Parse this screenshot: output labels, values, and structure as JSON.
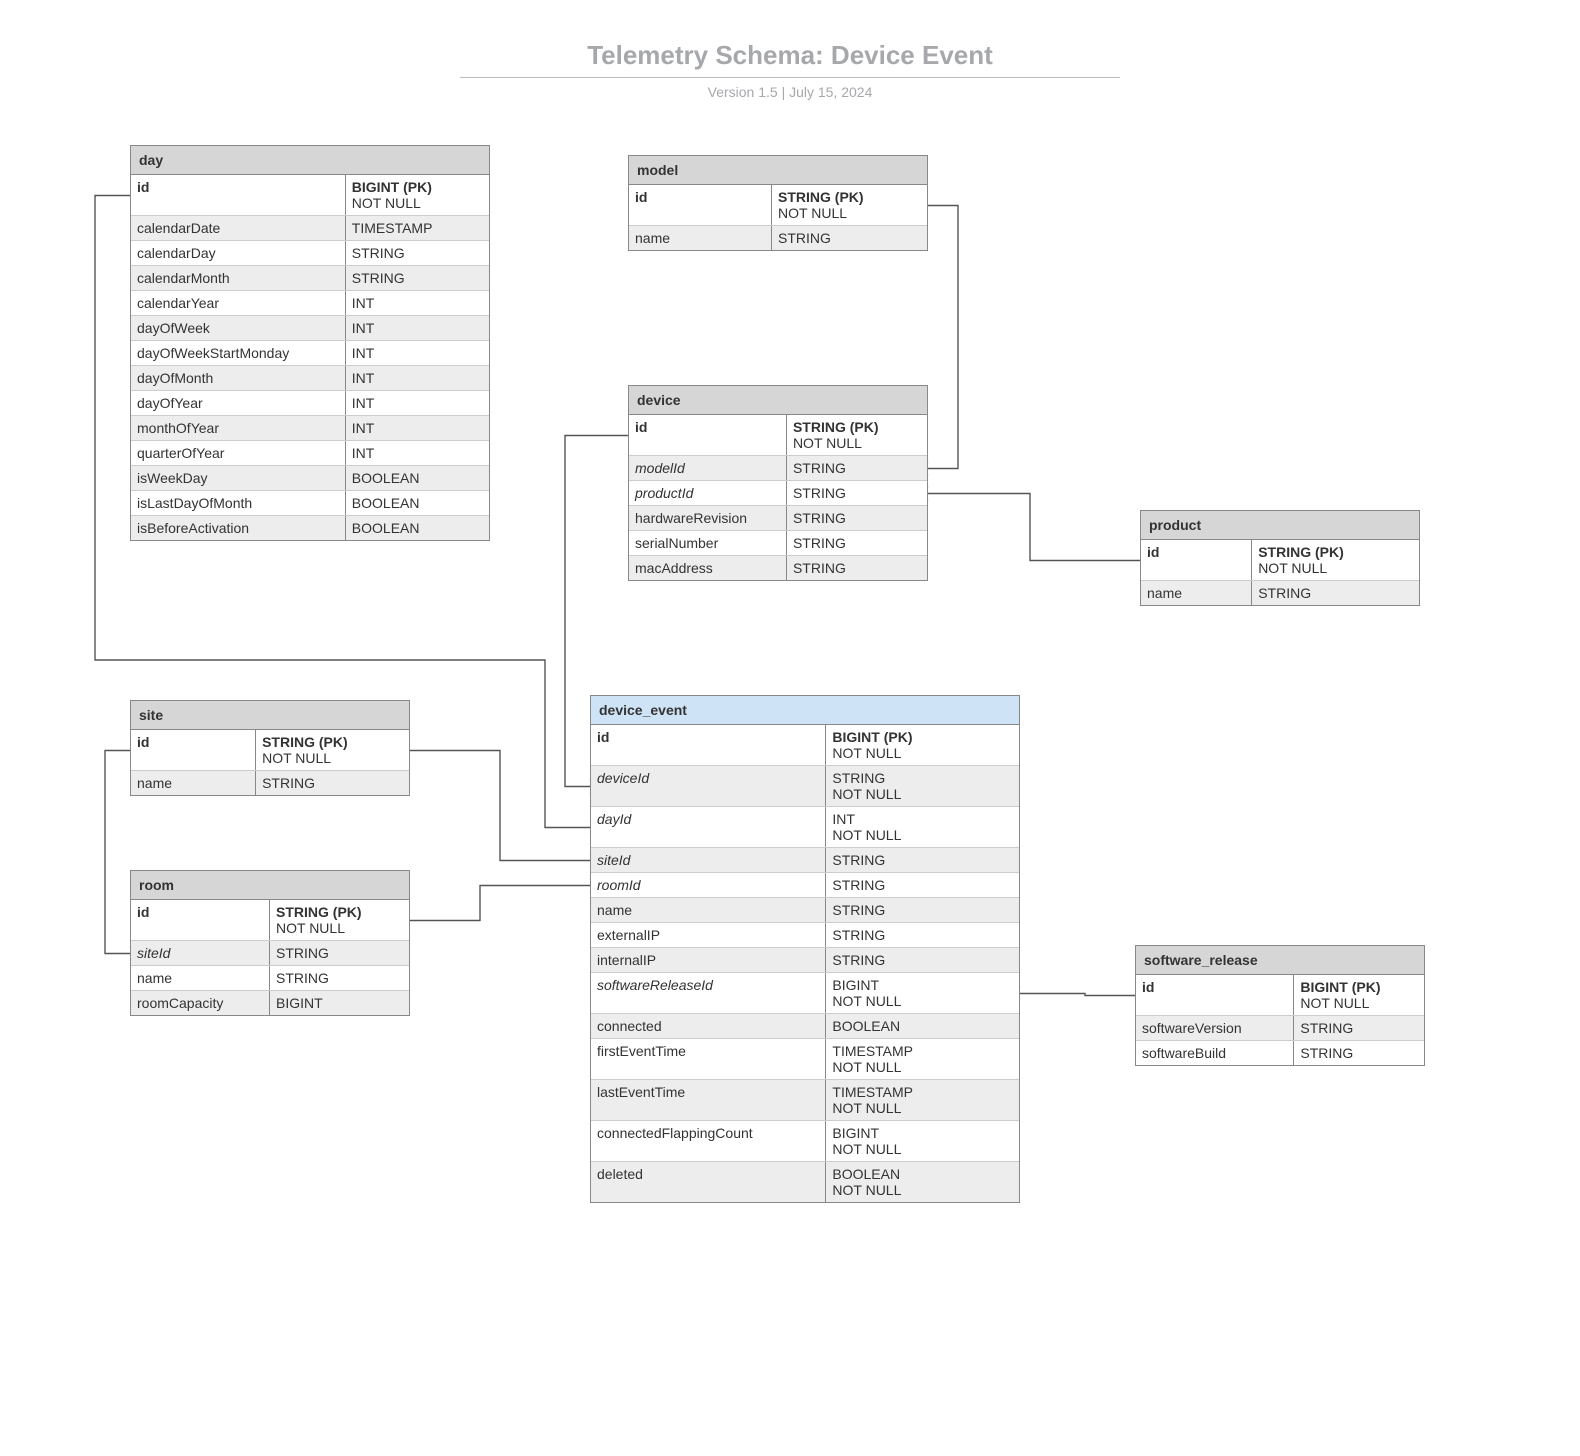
{
  "title": "Telemetry Schema: Device Event",
  "subtitle": "Version 1.5  |  July 15, 2024",
  "entities": {
    "day": {
      "name": "day",
      "columns": [
        {
          "name": "id",
          "type": "BIGINT (PK)",
          "nn": "NOT NULL",
          "pk": true
        },
        {
          "name": "calendarDate",
          "type": "TIMESTAMP"
        },
        {
          "name": "calendarDay",
          "type": "STRING"
        },
        {
          "name": "calendarMonth",
          "type": "STRING"
        },
        {
          "name": "calendarYear",
          "type": "INT"
        },
        {
          "name": "dayOfWeek",
          "type": "INT"
        },
        {
          "name": "dayOfWeekStartMonday",
          "type": "INT"
        },
        {
          "name": "dayOfMonth",
          "type": "INT"
        },
        {
          "name": "dayOfYear",
          "type": "INT"
        },
        {
          "name": "monthOfYear",
          "type": "INT"
        },
        {
          "name": "quarterOfYear",
          "type": "INT"
        },
        {
          "name": "isWeekDay",
          "type": "BOOLEAN"
        },
        {
          "name": "isLastDayOfMonth",
          "type": "BOOLEAN"
        },
        {
          "name": "isBeforeActivation",
          "type": "BOOLEAN"
        }
      ]
    },
    "model": {
      "name": "model",
      "columns": [
        {
          "name": "id",
          "type": "STRING (PK)",
          "nn": "NOT NULL",
          "pk": true
        },
        {
          "name": "name",
          "type": "STRING"
        }
      ]
    },
    "device": {
      "name": "device",
      "columns": [
        {
          "name": "id",
          "type": "STRING (PK)",
          "nn": "NOT NULL",
          "pk": true
        },
        {
          "name": "modelId",
          "type": "STRING",
          "fk": true
        },
        {
          "name": "productId",
          "type": "STRING",
          "fk": true
        },
        {
          "name": "hardwareRevision",
          "type": "STRING"
        },
        {
          "name": "serialNumber",
          "type": "STRING"
        },
        {
          "name": "macAddress",
          "type": "STRING"
        }
      ]
    },
    "product": {
      "name": "product",
      "columns": [
        {
          "name": "id",
          "type": "STRING (PK)",
          "nn": "NOT NULL",
          "pk": true
        },
        {
          "name": "name",
          "type": "STRING"
        }
      ]
    },
    "site": {
      "name": "site",
      "columns": [
        {
          "name": "id",
          "type": "STRING (PK)",
          "nn": "NOT NULL",
          "pk": true
        },
        {
          "name": "name",
          "type": "STRING"
        }
      ]
    },
    "room": {
      "name": "room",
      "columns": [
        {
          "name": "id",
          "type": "STRING (PK)",
          "nn": "NOT NULL",
          "pk": true
        },
        {
          "name": "siteId",
          "type": "STRING",
          "fk": true
        },
        {
          "name": "name",
          "type": "STRING"
        },
        {
          "name": "roomCapacity",
          "type": "BIGINT"
        }
      ]
    },
    "device_event": {
      "name": "device_event",
      "columns": [
        {
          "name": "id",
          "type": "BIGINT (PK)",
          "nn": "NOT NULL",
          "pk": true
        },
        {
          "name": "deviceId",
          "type": "STRING",
          "nn": "NOT NULL",
          "fk": true
        },
        {
          "name": "dayId",
          "type": "INT",
          "nn": "NOT NULL",
          "fk": true
        },
        {
          "name": "siteId",
          "type": "STRING",
          "fk": true
        },
        {
          "name": "roomId",
          "type": "STRING",
          "fk": true
        },
        {
          "name": "name",
          "type": "STRING"
        },
        {
          "name": "externalIP",
          "type": "STRING"
        },
        {
          "name": "internalIP",
          "type": "STRING"
        },
        {
          "name": "softwareReleaseId",
          "type": "BIGINT",
          "nn": "NOT NULL",
          "fk": true
        },
        {
          "name": "connected",
          "type": "BOOLEAN"
        },
        {
          "name": "firstEventTime",
          "type": "TIMESTAMP",
          "nn": "NOT NULL"
        },
        {
          "name": "lastEventTime",
          "type": "TIMESTAMP",
          "nn": "NOT NULL"
        },
        {
          "name": "connectedFlappingCount",
          "type": "BIGINT",
          "nn": "NOT NULL"
        },
        {
          "name": "deleted",
          "type": "BOOLEAN",
          "nn": "NOT NULL"
        }
      ]
    },
    "software_release": {
      "name": "software_release",
      "columns": [
        {
          "name": "id",
          "type": "BIGINT (PK)",
          "nn": "NOT NULL",
          "pk": true
        },
        {
          "name": "softwareVersion",
          "type": "STRING"
        },
        {
          "name": "softwareBuild",
          "type": "STRING"
        }
      ]
    }
  },
  "relationships": [
    {
      "from": "device_event.deviceId",
      "to": "device.id"
    },
    {
      "from": "device_event.dayId",
      "to": "day.id"
    },
    {
      "from": "device_event.siteId",
      "to": "site.id"
    },
    {
      "from": "device_event.roomId",
      "to": "room.id"
    },
    {
      "from": "device_event.softwareReleaseId",
      "to": "software_release.id"
    },
    {
      "from": "device.modelId",
      "to": "model.id"
    },
    {
      "from": "device.productId",
      "to": "product.id"
    },
    {
      "from": "room.siteId",
      "to": "site.id"
    }
  ]
}
